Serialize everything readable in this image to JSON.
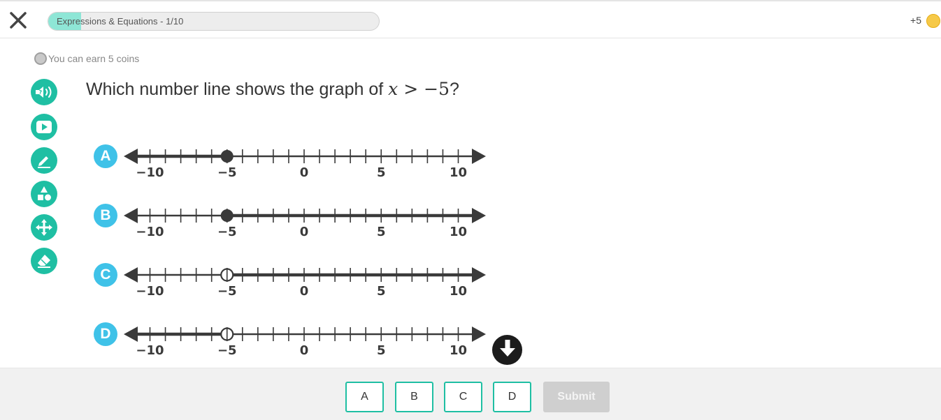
{
  "header": {
    "close_icon": "close-icon",
    "progress": {
      "label": "Expressions & Equations - 1/10",
      "fraction": 0.1
    },
    "coins": {
      "value": "+5",
      "icon": "coin-icon",
      "color": "#f6c948"
    }
  },
  "earn_note": {
    "text": "You can earn 5 coins",
    "icon": "coin-outline-icon"
  },
  "tools": [
    {
      "icon": "read-aloud-icon"
    },
    {
      "icon": "video-icon"
    },
    {
      "icon": "pencil-icon"
    },
    {
      "icon": "shapes-icon"
    },
    {
      "icon": "move-icon"
    },
    {
      "icon": "eraser-icon"
    }
  ],
  "question": {
    "prefix": "Which number line shows the graph of ",
    "var": "x",
    "relation": " > −5",
    "suffix": "?"
  },
  "number_line": {
    "min": -12,
    "max": 12,
    "tick_step": 1,
    "tick_labels": [
      "−10",
      "−5",
      "0",
      "5",
      "10"
    ],
    "tick_label_values": [
      -10,
      -5,
      0,
      5,
      10
    ]
  },
  "options": [
    {
      "letter": "A",
      "point": -5,
      "closed": true,
      "direction": "left"
    },
    {
      "letter": "B",
      "point": -5,
      "closed": true,
      "direction": "right"
    },
    {
      "letter": "C",
      "point": -5,
      "closed": false,
      "direction": "right"
    },
    {
      "letter": "D",
      "point": -5,
      "closed": false,
      "direction": "left"
    }
  ],
  "footer": {
    "answers": [
      "A",
      "B",
      "C",
      "D"
    ],
    "submit_label": "Submit"
  },
  "colors": {
    "accent": "#1fbfa3",
    "option_badge": "#3fc2e8",
    "line": "#3a3a3a"
  }
}
